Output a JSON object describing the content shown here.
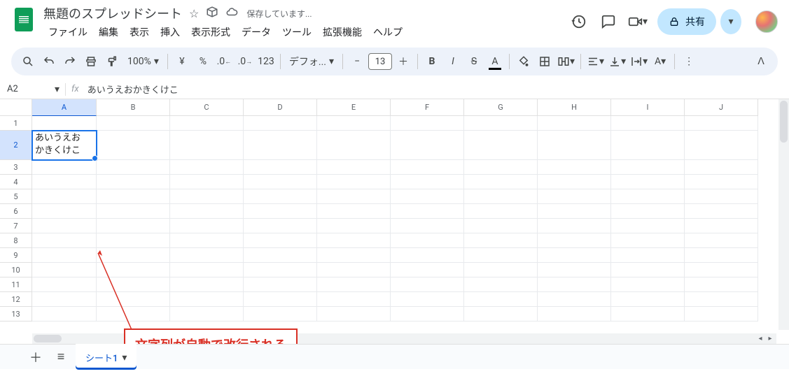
{
  "header": {
    "doc_title": "無題のスプレッドシート",
    "save_status": "保存しています...",
    "share_label": "共有"
  },
  "menu": [
    "ファイル",
    "編集",
    "表示",
    "挿入",
    "表示形式",
    "データ",
    "ツール",
    "拡張機能",
    "ヘルプ"
  ],
  "toolbar": {
    "zoom": "100%",
    "currency": "¥",
    "percent": "%",
    "digits": "123",
    "font": "デフォ...",
    "font_size": "13"
  },
  "namebox": {
    "cell_ref": "A2",
    "fx": "fx",
    "formula": "あいうえおかきくけこ"
  },
  "columns": [
    "A",
    "B",
    "C",
    "D",
    "E",
    "F",
    "G",
    "H",
    "I",
    "J"
  ],
  "rows": [
    "1",
    "2",
    "3",
    "4",
    "5",
    "6",
    "7",
    "8",
    "9",
    "10",
    "11",
    "12",
    "13"
  ],
  "cells": {
    "A2_line1": "あいうえお",
    "A2_line2": "かきくけこ"
  },
  "sheetbar": {
    "sheet1": "シート1"
  },
  "annotation": {
    "text": "文字列が自動で改行される"
  }
}
